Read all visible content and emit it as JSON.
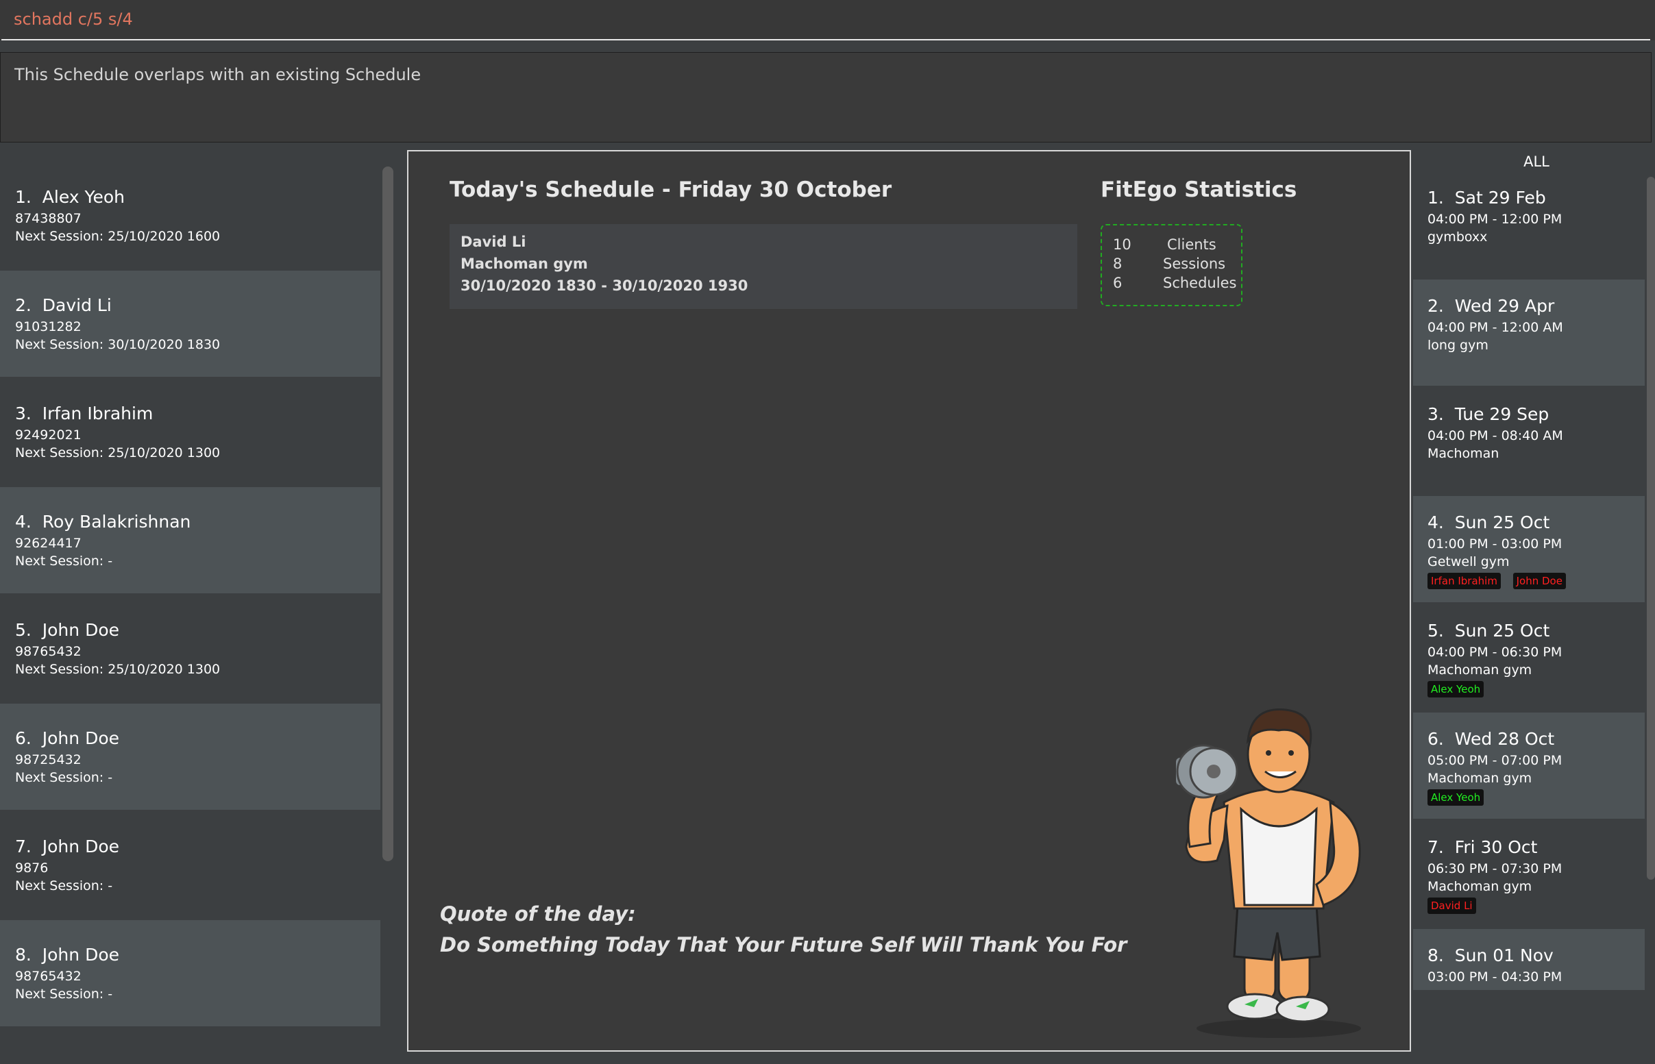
{
  "command": {
    "value": "schadd c/5 s/4"
  },
  "result": {
    "text": "This Schedule overlaps with an existing Schedule"
  },
  "clients": [
    {
      "index": "1.",
      "name": "Alex Yeoh",
      "phone": "87438807",
      "next_session": "Next Session: 25/10/2020 1600"
    },
    {
      "index": "2.",
      "name": "David Li",
      "phone": "91031282",
      "next_session": "Next Session: 30/10/2020 1830"
    },
    {
      "index": "3.",
      "name": "Irfan Ibrahim",
      "phone": "92492021",
      "next_session": "Next Session: 25/10/2020 1300"
    },
    {
      "index": "4.",
      "name": "Roy Balakrishnan",
      "phone": "92624417",
      "next_session": "Next Session:  -"
    },
    {
      "index": "5.",
      "name": "John Doe",
      "phone": "98765432",
      "next_session": "Next Session: 25/10/2020 1300"
    },
    {
      "index": "6.",
      "name": "John Doe",
      "phone": "98725432",
      "next_session": "Next Session:  -"
    },
    {
      "index": "7.",
      "name": "John Doe",
      "phone": "9876",
      "next_session": "Next Session:  -"
    },
    {
      "index": "8.",
      "name": "John Doe",
      "phone": "98765432",
      "next_session": "Next Session:  -"
    }
  ],
  "today": {
    "title": "Today's Schedule - Friday 30 October",
    "session": {
      "client": "David Li",
      "gym": "Machoman gym",
      "time": "30/10/2020 1830 - 30/10/2020 1930"
    }
  },
  "stats": {
    "title": "FitEgo Statistics",
    "rows": [
      {
        "count": "10",
        "label": "Clients"
      },
      {
        "count": "8",
        "label": "Sessions"
      },
      {
        "count": "6",
        "label": "Schedules"
      }
    ]
  },
  "quote": {
    "label": "Quote of the day:",
    "text": "Do Something Today That Your Future Self Will Thank You For"
  },
  "schedule_filter": "ALL",
  "schedules": [
    {
      "index": "1.",
      "date": "Sat 29 Feb",
      "time": "04:00 PM - 12:00 PM",
      "venue": "gymboxx",
      "tags": []
    },
    {
      "index": "2.",
      "date": "Wed 29 Apr",
      "time": "04:00 PM - 12:00 AM",
      "venue": "long gym",
      "tags": []
    },
    {
      "index": "3.",
      "date": "Tue 29 Sep",
      "time": "04:00 PM - 08:40 AM",
      "venue": "Machoman",
      "tags": []
    },
    {
      "index": "4.",
      "date": "Sun 25 Oct",
      "time": "01:00 PM - 03:00 PM",
      "venue": "Getwell gym",
      "tags": [
        {
          "text": "Irfan Ibrahim",
          "color": "#ff2020"
        },
        {
          "text": "John Doe",
          "color": "#ff2020"
        }
      ]
    },
    {
      "index": "5.",
      "date": "Sun 25 Oct",
      "time": "04:00 PM - 06:30 PM",
      "venue": "Machoman gym",
      "tags": [
        {
          "text": "Alex Yeoh",
          "color": "#22ee22"
        }
      ]
    },
    {
      "index": "6.",
      "date": "Wed 28 Oct",
      "time": "05:00 PM - 07:00 PM",
      "venue": "Machoman gym",
      "tags": [
        {
          "text": "Alex Yeoh",
          "color": "#22ee22"
        }
      ]
    },
    {
      "index": "7.",
      "date": "Fri 30 Oct",
      "time": "06:30 PM - 07:30 PM",
      "venue": "Machoman gym",
      "tags": [
        {
          "text": "David Li",
          "color": "#ff2020"
        }
      ]
    },
    {
      "index": "8.",
      "date": "Sun 01 Nov",
      "time": "03:00 PM - 04:30 PM",
      "venue": "",
      "tags": []
    }
  ],
  "colors": {
    "background": "#3c3f41",
    "card_alt": "#4d5356",
    "command_text": "#e2765f",
    "stats_border": "#22aa22"
  }
}
